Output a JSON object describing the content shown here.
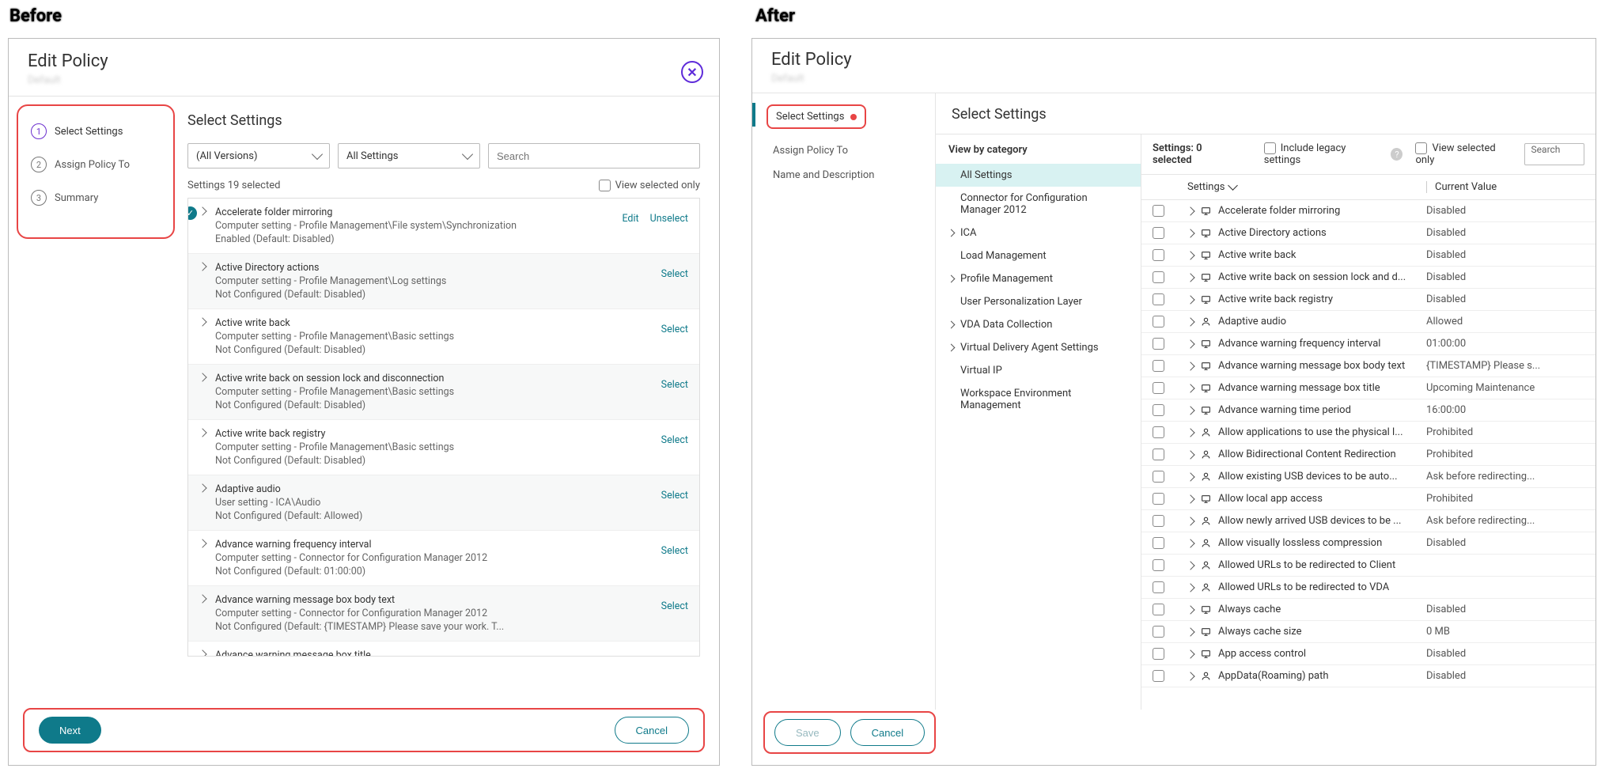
{
  "labels": {
    "before": "Before",
    "after": "After"
  },
  "before": {
    "title": "Edit Policy",
    "subtitle": "Default",
    "steps": [
      {
        "n": "1",
        "label": "Select Settings",
        "active": true
      },
      {
        "n": "2",
        "label": "Assign Policy To",
        "active": false
      },
      {
        "n": "3",
        "label": "Summary",
        "active": false
      }
    ],
    "heading": "Select Settings",
    "versionsDropdown": "(All Versions)",
    "settingsDropdown": "All Settings",
    "searchPlaceholder": "Search",
    "selectedCount": "Settings 19 selected",
    "viewSelectedOnly": "View selected only",
    "editAction": "Edit",
    "unselectAction": "Unselect",
    "selectAction": "Select",
    "items": [
      {
        "title": "Accelerate folder mirroring",
        "path": "Computer setting - Profile Management\\File system\\Synchronization",
        "state": "Enabled (Default: Disabled)",
        "checked": true,
        "actions": [
          "edit",
          "unselect"
        ]
      },
      {
        "title": "Active Directory actions",
        "path": "Computer setting - Profile Management\\Log settings",
        "state": "Not Configured (Default: Disabled)",
        "checked": false,
        "actions": [
          "select"
        ]
      },
      {
        "title": "Active write back",
        "path": "Computer setting - Profile Management\\Basic settings",
        "state": "Not Configured (Default: Disabled)",
        "checked": false,
        "actions": [
          "select"
        ]
      },
      {
        "title": "Active write back on session lock and disconnection",
        "path": "Computer setting - Profile Management\\Basic settings",
        "state": "Not Configured (Default: Disabled)",
        "checked": false,
        "actions": [
          "select"
        ]
      },
      {
        "title": "Active write back registry",
        "path": "Computer setting - Profile Management\\Basic settings",
        "state": "Not Configured (Default: Disabled)",
        "checked": false,
        "actions": [
          "select"
        ]
      },
      {
        "title": "Adaptive audio",
        "path": "User setting - ICA\\Audio",
        "state": "Not Configured (Default: Allowed)",
        "checked": false,
        "actions": [
          "select"
        ]
      },
      {
        "title": "Advance warning frequency interval",
        "path": "Computer setting - Connector for Configuration Manager 2012",
        "state": "Not Configured (Default: 01:00:00)",
        "checked": false,
        "actions": [
          "select"
        ]
      },
      {
        "title": "Advance warning message box body text",
        "path": "Computer setting - Connector for Configuration Manager 2012",
        "state": "Not Configured (Default: {TIMESTAMP} Please save your work. T...",
        "checked": false,
        "actions": [
          "select"
        ]
      },
      {
        "title": "Advance warning message box title",
        "path": "",
        "state": "",
        "checked": false,
        "actions": []
      }
    ],
    "nextBtn": "Next",
    "cancelBtn": "Cancel"
  },
  "after": {
    "title": "Edit Policy",
    "subtitle": "Default",
    "nav": [
      {
        "label": "Select Settings",
        "highlight": true
      },
      {
        "label": "Assign Policy To",
        "highlight": false
      },
      {
        "label": "Name and Description",
        "highlight": false
      }
    ],
    "heading": "Select Settings",
    "viewByCategory": "View by category",
    "categories": [
      {
        "label": "All Settings",
        "expandable": false,
        "active": true
      },
      {
        "label": "Connector for Configuration Manager 2012",
        "expandable": false
      },
      {
        "label": "ICA",
        "expandable": true
      },
      {
        "label": "Load Management",
        "expandable": false
      },
      {
        "label": "Profile Management",
        "expandable": true
      },
      {
        "label": "User Personalization Layer",
        "expandable": false
      },
      {
        "label": "VDA Data Collection",
        "expandable": true
      },
      {
        "label": "Virtual Delivery Agent Settings",
        "expandable": true
      },
      {
        "label": "Virtual IP",
        "expandable": false
      },
      {
        "label": "Workspace Environment Management",
        "expandable": false
      }
    ],
    "settingsCount": "Settings: 0 selected",
    "includeLegacy": "Include legacy settings",
    "viewSelectedOnly": "View selected only",
    "searchLabel": "Search",
    "colSettings": "Settings",
    "colValue": "Current Value",
    "rows": [
      {
        "icon": "computer",
        "name": "Accelerate folder mirroring",
        "value": "Disabled"
      },
      {
        "icon": "computer",
        "name": "Active Directory actions",
        "value": "Disabled"
      },
      {
        "icon": "computer",
        "name": "Active write back",
        "value": "Disabled"
      },
      {
        "icon": "computer",
        "name": "Active write back on session lock and d...",
        "value": "Disabled"
      },
      {
        "icon": "computer",
        "name": "Active write back registry",
        "value": "Disabled"
      },
      {
        "icon": "user",
        "name": "Adaptive audio",
        "value": "Allowed"
      },
      {
        "icon": "computer",
        "name": "Advance warning frequency interval",
        "value": "01:00:00"
      },
      {
        "icon": "computer",
        "name": "Advance warning message box body text",
        "value": "{TIMESTAMP} Please s..."
      },
      {
        "icon": "computer",
        "name": "Advance warning message box title",
        "value": "Upcoming Maintenance"
      },
      {
        "icon": "computer",
        "name": "Advance warning time period",
        "value": "16:00:00"
      },
      {
        "icon": "user",
        "name": "Allow applications to use the physical l...",
        "value": "Prohibited"
      },
      {
        "icon": "user",
        "name": "Allow Bidirectional Content Redirection",
        "value": "Prohibited"
      },
      {
        "icon": "user",
        "name": "Allow existing USB devices to be auto...",
        "value": "Ask before redirecting..."
      },
      {
        "icon": "computer",
        "name": "Allow local app access",
        "value": "Prohibited"
      },
      {
        "icon": "user",
        "name": "Allow newly arrived USB devices to be ...",
        "value": "Ask before redirecting..."
      },
      {
        "icon": "user",
        "name": "Allow visually lossless compression",
        "value": "Disabled"
      },
      {
        "icon": "user",
        "name": "Allowed URLs to be redirected to Client",
        "value": ""
      },
      {
        "icon": "user",
        "name": "Allowed URLs to be redirected to VDA",
        "value": ""
      },
      {
        "icon": "computer",
        "name": "Always cache",
        "value": "Disabled"
      },
      {
        "icon": "computer",
        "name": "Always cache size",
        "value": "0 MB"
      },
      {
        "icon": "computer",
        "name": "App access control",
        "value": "Disabled"
      },
      {
        "icon": "user",
        "name": "AppData(Roaming) path",
        "value": "Disabled"
      }
    ],
    "saveBtn": "Save",
    "cancelBtn": "Cancel"
  }
}
